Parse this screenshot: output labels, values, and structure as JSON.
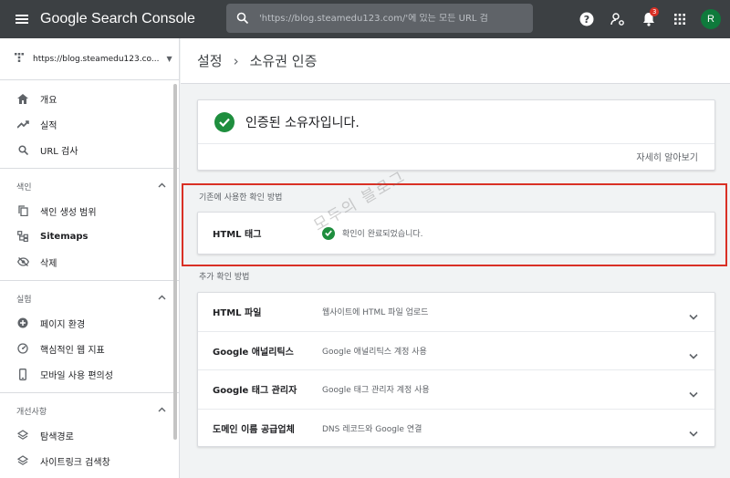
{
  "header": {
    "app_title": "Google Search Console",
    "search_placeholder": "'https://blog.steamedu123.com/'에 있는 모든 URL 검",
    "notification_count": "3",
    "avatar_letter": "R"
  },
  "sidebar": {
    "property": "https://blog.steamedu123.co...",
    "top_items": [
      {
        "label": "개요",
        "icon": "home-icon"
      },
      {
        "label": "실적",
        "icon": "trending-icon"
      },
      {
        "label": "URL 검사",
        "icon": "search-icon"
      }
    ],
    "sections": [
      {
        "title": "색인",
        "items": [
          {
            "label": "색인 생성 범위",
            "icon": "copy-icon"
          },
          {
            "label": "Sitemaps",
            "icon": "sitemap-icon"
          },
          {
            "label": "삭제",
            "icon": "eye-off-icon"
          }
        ]
      },
      {
        "title": "실험",
        "items": [
          {
            "label": "페이지 환경",
            "icon": "plus-circle-icon"
          },
          {
            "label": "핵심적인 웹 지표",
            "icon": "gauge-icon"
          },
          {
            "label": "모바일 사용 편의성",
            "icon": "phone-icon"
          }
        ]
      },
      {
        "title": "개선사항",
        "items": [
          {
            "label": "탐색경로",
            "icon": "layers-icon"
          },
          {
            "label": "사이트링크 검색창",
            "icon": "layers-icon"
          }
        ]
      }
    ]
  },
  "main": {
    "breadcrumb": {
      "parent": "설정",
      "current": "소유권 인증"
    },
    "verified_text": "인증된 소유자입니다.",
    "learn_more": "자세히 알아보기",
    "previous_label": "기존에 사용한 확인 방법",
    "previous_method": {
      "name": "HTML 태그",
      "status": "확인이 완료되었습니다."
    },
    "additional_label": "추가 확인 방법",
    "additional_methods": [
      {
        "name": "HTML 파일",
        "desc": "웹사이트에 HTML 파일 업로드"
      },
      {
        "name": "Google 애널리틱스",
        "desc": "Google 애널리틱스 계정 사용"
      },
      {
        "name": "Google 태그 관리자",
        "desc": "Google 태그 관리자 계정 사용"
      },
      {
        "name": "도메인 이름 공급업체",
        "desc": "DNS 레코드와 Google 연결"
      }
    ],
    "watermark": "모두의 블로그"
  },
  "colors": {
    "topbar": "#3c4043",
    "success": "#1e8e3e",
    "highlight": "#d93025"
  }
}
